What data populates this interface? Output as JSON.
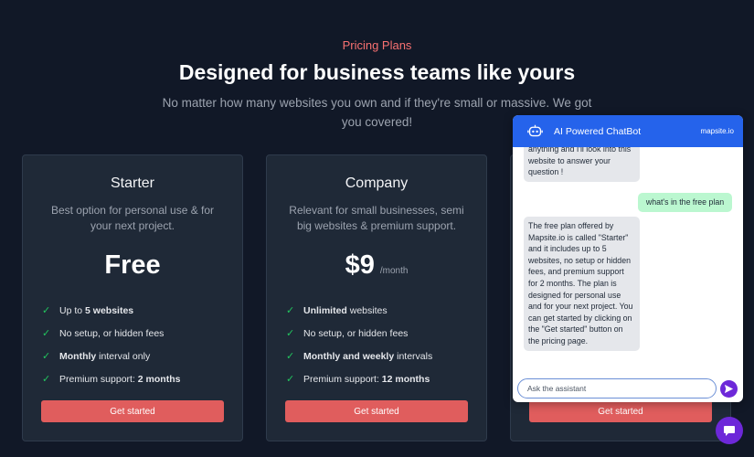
{
  "header": {
    "eyebrow": "Pricing Plans",
    "title": "Designed for business teams like yours",
    "subtitle": "No matter how many websites you own and if they're small or massive. We got you covered!"
  },
  "plans": [
    {
      "name": "Starter",
      "description": "Best option for personal use & for your next project.",
      "price": "Free",
      "period": "",
      "features": [
        {
          "pre": "Up to ",
          "bold": "5 websites",
          "post": ""
        },
        {
          "pre": "No setup, or hidden fees",
          "bold": "",
          "post": ""
        },
        {
          "pre": "",
          "bold": "Monthly",
          "post": " interval only"
        },
        {
          "pre": "Premium support: ",
          "bold": "2 months",
          "post": ""
        }
      ],
      "cta": "Get started"
    },
    {
      "name": "Company",
      "description": "Relevant for small businesses, semi big websites & premium support.",
      "price": "$9",
      "period": "/month",
      "features": [
        {
          "pre": "",
          "bold": "Unlimited",
          "post": " websites"
        },
        {
          "pre": "No setup, or hidden fees",
          "bold": "",
          "post": ""
        },
        {
          "pre": "",
          "bold": "Monthly and weekly",
          "post": " intervals"
        },
        {
          "pre": "Premium support: ",
          "bold": "12 months",
          "post": ""
        }
      ],
      "cta": "Get started"
    },
    {
      "cta": "Get started"
    }
  ],
  "chat": {
    "title": "AI Powered ChatBot",
    "brand": "mapsite.io",
    "messages": [
      {
        "role": "bot",
        "text": "anything and I'll look into this website to answer your question !"
      },
      {
        "role": "user",
        "text": "what's in the free plan"
      },
      {
        "role": "bot",
        "text": "The free plan offered by Mapsite.io is called \"Starter\" and it includes up to 5 websites, no setup or hidden fees, and premium support for 2 months. The plan is designed for personal use and for your next project. You can get started by clicking on the \"Get started\" button on the pricing page."
      }
    ],
    "input_placeholder": "Ask the assistant",
    "input_value": ""
  },
  "colors": {
    "background": "#111827",
    "card": "#1f2937",
    "accent": "#e05d5d",
    "eyebrow": "#f87171",
    "check": "#22c55e",
    "chat_header": "#2563eb",
    "chat_button": "#6d28d9"
  },
  "icons": {
    "feature": "check-icon",
    "chat_header": "bot-icon",
    "send": "send-icon",
    "launcher": "chat-bubble-icon"
  }
}
